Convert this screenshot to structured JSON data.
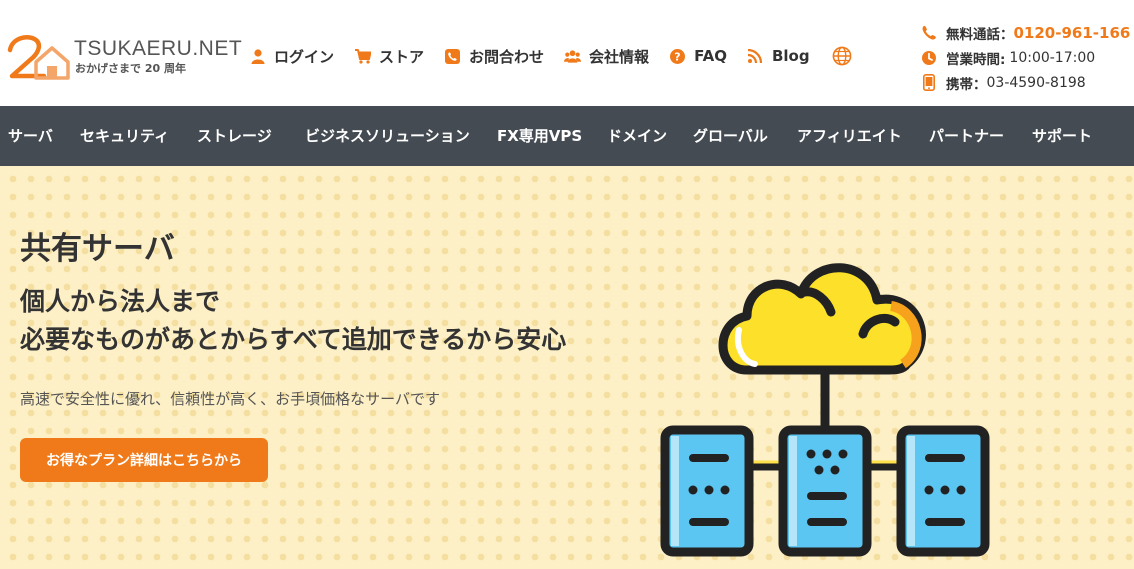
{
  "brand": {
    "name": "TSUKAERU.NET",
    "tagline": "おかげさまで 20 周年",
    "accent_color": "#f07a1a",
    "nav_bg_color": "#444b52"
  },
  "top_nav": [
    {
      "label": "ログイン",
      "icon": "user-icon"
    },
    {
      "label": "ストア",
      "icon": "cart-icon"
    },
    {
      "label": "お問合わせ",
      "icon": "phone-square-icon"
    },
    {
      "label": "会社情報",
      "icon": "users-icon"
    },
    {
      "label": "FAQ",
      "icon": "question-circle-icon"
    },
    {
      "label": "Blog",
      "icon": "rss-icon"
    }
  ],
  "language_icon": "globe-icon",
  "contact": {
    "freecall_label": "無料通話：",
    "freecall_number": "0120-961-166",
    "hours_label": "営業時間:",
    "hours_value": "10:00-17:00",
    "mobile_label": "携帯：",
    "mobile_number": "03-4590-8198"
  },
  "main_nav": [
    "サーバ",
    "セキュリティ",
    "ストレージ",
    "ビジネスソリューション",
    "FX専用VPS",
    "ドメイン",
    "グローバル",
    "アフィリエイト",
    "パートナー",
    "サポート"
  ],
  "hero": {
    "title": "共有サーバ",
    "subtitle_line1": "個人から法人まで",
    "subtitle_line2": "必要なものがあとからすべて追加できるから安心",
    "description": "高速で安全性に優れ、信頼性が高く、お手頃価格なサーバです",
    "cta_label": "お得なプラン詳細はこちらから",
    "illustration_icon": "cloud-server-network-icon"
  }
}
